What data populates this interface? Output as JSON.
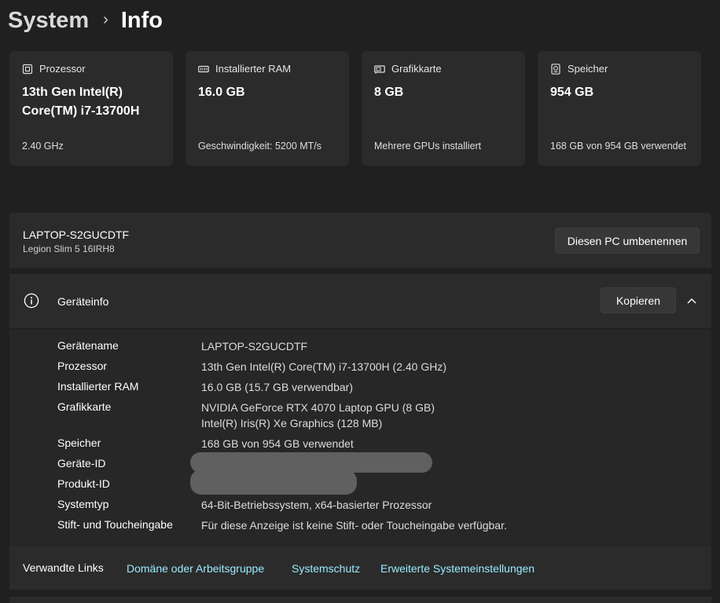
{
  "breadcrumb": {
    "parent": "System",
    "separator": "›",
    "current": "Info"
  },
  "cards": [
    {
      "icon": "processor-icon",
      "title": "Prozessor",
      "value": "13th Gen Intel(R) Core(TM) i7-13700H",
      "sub": "2.40 GHz"
    },
    {
      "icon": "ram-icon",
      "title": "Installierter RAM",
      "value": "16.0 GB",
      "sub": "Geschwindigkeit: 5200 MT/s"
    },
    {
      "icon": "graphics-card-icon",
      "title": "Grafikkarte",
      "value": "8 GB",
      "sub": "Mehrere GPUs installiert"
    },
    {
      "icon": "storage-icon",
      "title": "Speicher",
      "value": "954 GB",
      "sub": "168 GB von 954 GB verwendet"
    }
  ],
  "pc": {
    "name": "LAPTOP-S2GUCDTF",
    "model": "Legion Slim 5 16IRH8",
    "rename_label": "Diesen PC umbenennen"
  },
  "device": {
    "title": "Geräteinfo",
    "copy_label": "Kopieren",
    "specs": [
      {
        "label": "Gerätename",
        "value": "LAPTOP-S2GUCDTF"
      },
      {
        "label": "Prozessor",
        "value": "13th Gen Intel(R) Core(TM) i7-13700H (2.40 GHz)"
      },
      {
        "label": "Installierter RAM",
        "value": "16.0 GB (15.7 GB verwendbar)"
      },
      {
        "label": "Grafikkarte",
        "value": "NVIDIA GeForce RTX 4070 Laptop GPU (8 GB)",
        "value2": "Intel(R) Iris(R) Xe Graphics (128 MB)"
      },
      {
        "label": "Speicher",
        "value": "168 GB von 954 GB verwendet"
      },
      {
        "label": "Geräte-ID",
        "value": ""
      },
      {
        "label": "Produkt-ID",
        "value": ""
      },
      {
        "label": "Systemtyp",
        "value": "64-Bit-Betriebssystem, x64-basierter Prozessor"
      },
      {
        "label": "Stift- und Toucheingabe",
        "value": "Für diese Anzeige ist keine Stift- oder Toucheingabe verfügbar."
      }
    ]
  },
  "related": {
    "title": "Verwandte Links",
    "links": [
      "Domäne oder Arbeitsgruppe",
      "Systemschutz",
      "Erweiterte Systemeinstellungen"
    ]
  },
  "colors": {
    "background": "#202020",
    "card": "#2b2b2b",
    "link": "#99ebff"
  }
}
